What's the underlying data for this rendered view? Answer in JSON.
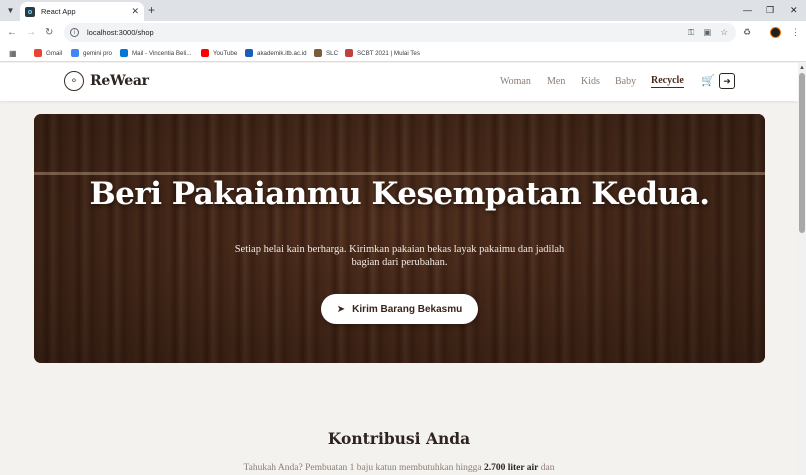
{
  "browser": {
    "tab_title": "React App",
    "url": "localhost:3000/shop",
    "bookmarks": [
      {
        "label": "Gmail",
        "color": "#ea4335"
      },
      {
        "label": "gemini pro",
        "color": "#4285f4"
      },
      {
        "label": "Mail - Vincentia Beli...",
        "color": "#0078d4"
      },
      {
        "label": "YouTube",
        "color": "#ff0000"
      },
      {
        "label": "akademik.itb.ac.id",
        "color": "#1a5fb4"
      },
      {
        "label": "SLC",
        "color": "#7a5c3c"
      },
      {
        "label": "SCBT 2021 | Mulai Tes",
        "color": "#c04040"
      }
    ]
  },
  "site": {
    "brand": "ReWear",
    "nav": [
      "Woman",
      "Men",
      "Kids",
      "Baby",
      "Recycle"
    ],
    "active_nav": "Recycle"
  },
  "hero": {
    "title": "Beri Pakaianmu Kesempatan Kedua.",
    "subtitle": "Setiap helai kain berharga. Kirimkan pakaian bekas layak pakaimu dan jadilah bagian dari perubahan.",
    "cta_label": "Kirim Barang Bekasmu"
  },
  "contribution": {
    "title": "Kontribusi Anda",
    "text_before": "Tahukah Anda? Pembuatan 1 baju katun membutuhkan hingga ",
    "text_highlight": "2.700 liter air",
    "text_after": " dan"
  },
  "colors": {
    "brand_dark": "#2d2420",
    "accent": "#4a2a1e",
    "background": "#f4f2ef"
  }
}
